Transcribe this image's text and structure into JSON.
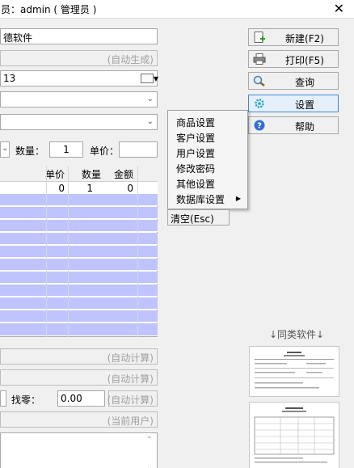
{
  "window": {
    "title": "员：admin ( 管理员 )",
    "close_glyph": "✕"
  },
  "form": {
    "company": "德软件",
    "order_no_hint": "(自动生成)",
    "date": "13",
    "qty_label": "数量：",
    "qty_value": "1",
    "price_label": "单价："
  },
  "grid": {
    "headers": {
      "price": "单价",
      "qty": "数量",
      "amount": "金额"
    },
    "first_row": {
      "price": "0",
      "qty": "1",
      "amount": "0"
    }
  },
  "totals": {
    "auto_calc_1": "(自动计算)",
    "auto_calc_2": "(自动计算)",
    "change_label": "找零：",
    "change_value": "0.00",
    "auto_calc_3": "(自动计算)",
    "current_user": "(当前用户)"
  },
  "toolbar": {
    "new": "新建(F2)",
    "print": "打印(F5)",
    "query": "查询",
    "settings": "设置",
    "help": "帮助"
  },
  "menu": {
    "items": [
      "商品设置",
      "客户设置",
      "用户设置",
      "修改密码",
      "其他设置",
      "数据库设置"
    ]
  },
  "clear_button": "清空(Esc)",
  "similar_software": "↓同类软件↓",
  "colors": {
    "grid_row": "#bfc4ff",
    "active_border": "#3c8bd8"
  }
}
